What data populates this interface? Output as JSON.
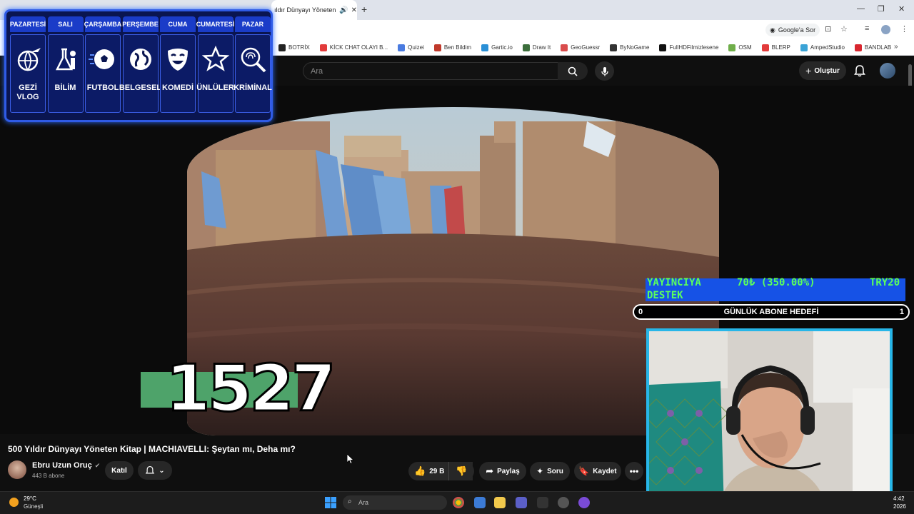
{
  "browser": {
    "tab_title": "ıldır Dünyayı Yöneten",
    "google_sor": "Google'a Sor",
    "bookmarks": [
      {
        "label": "BOTRİX",
        "color": "#222222"
      },
      {
        "label": "KİCK CHAT OLAYI B...",
        "color": "#e23b3b"
      },
      {
        "label": "Quizei",
        "color": "#4a7be0"
      },
      {
        "label": "Ben Bildim",
        "color": "#c0392b"
      },
      {
        "label": "Gartic.io",
        "color": "#2a8fd6"
      },
      {
        "label": "Draw It",
        "color": "#3c6e3c"
      },
      {
        "label": "GeoGuessr",
        "color": "#d94c4c"
      },
      {
        "label": "ByNoGame",
        "color": "#333333"
      },
      {
        "label": "FullHDFilmizlesene",
        "color": "#111111"
      },
      {
        "label": "OSM",
        "color": "#6fae4a"
      },
      {
        "label": "BLERP",
        "color": "#e23b3b"
      },
      {
        "label": "AmpedStudio",
        "color": "#3aa3d6"
      },
      {
        "label": "BANDLAB",
        "color": "#d8262f"
      }
    ]
  },
  "youtube": {
    "search_placeholder": "Ara",
    "create_label": "Oluştur",
    "video_year": "1527",
    "video_title": "500 Yıldır Dünyayı Yöneten Kitap | MACHIAVELLI: Şeytan mı, Deha mı?",
    "channel_name": "Ebru Uzun Oruç",
    "subscribers": "443 B abone",
    "join_label": "Katıl",
    "likes": "29 B",
    "share_label": "Paylaş",
    "ask_label": "Soru",
    "save_label": "Kaydet"
  },
  "schedule": {
    "days": [
      {
        "day": "PAZARTESİ",
        "label": "GEZİ VLOG",
        "icon": "globe-plane-icon"
      },
      {
        "day": "SALI",
        "label": "BİLİM",
        "icon": "lab-flask-icon"
      },
      {
        "day": "ÇARŞAMBA",
        "label": "FUTBOL",
        "icon": "soccer-ball-icon"
      },
      {
        "day": "PERŞEMBE",
        "label": "BELGESEL",
        "icon": "globe-icon"
      },
      {
        "day": "CUMA",
        "label": "KOMEDİ",
        "icon": "comedy-mask-icon"
      },
      {
        "day": "CUMARTESİ",
        "label": "ÜNLÜLER",
        "icon": "star-icon"
      },
      {
        "day": "PAZAR",
        "label": "KRİMİNAL",
        "icon": "fingerprint-icon"
      }
    ]
  },
  "donation": {
    "label_line1": "YAYINCIYA",
    "label_line2": "DESTEK",
    "amount": "70₺ (350.00%)",
    "target": "TRY20"
  },
  "goal": {
    "start": "0",
    "title": "GÜNLÜK ABONE HEDEFİ",
    "end": "1"
  },
  "taskbar": {
    "temperature": "29°C",
    "weather": "Güneşli",
    "search_placeholder": "Ara",
    "time": "4:42",
    "date": "2026"
  },
  "colors": {
    "schedule_bg": "#0a1550",
    "schedule_border": "#2f5be6",
    "donation_bg": "#1652e6",
    "donation_text": "#5cff5c",
    "cam_border": "#27b6e8"
  }
}
